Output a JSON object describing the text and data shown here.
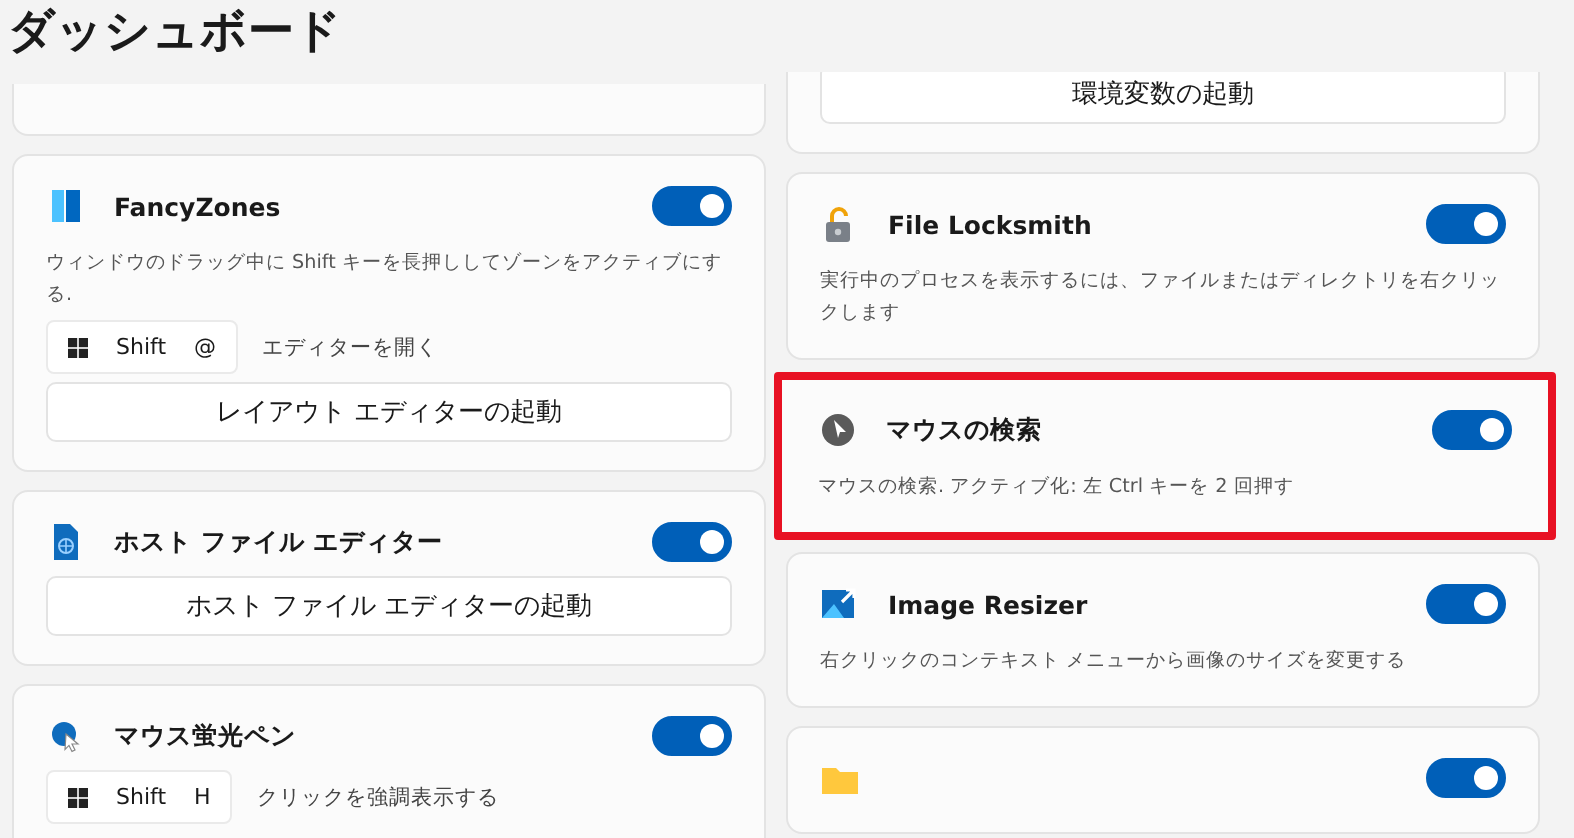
{
  "title": "ダッシュボード",
  "columns": [
    {
      "cards": [
        {
          "kind": "blank"
        },
        {
          "kind": "fancyzones",
          "title": "FancyZones",
          "enabled": true,
          "description": "ウィンドウのドラッグ中に Shift キーを長押ししてゾーンをアクティブにする.",
          "shortcut": {
            "keys": [
              "Shift",
              "@"
            ],
            "label": "エディターを開く"
          },
          "button": "レイアウト エディターの起動"
        },
        {
          "kind": "hosts",
          "title": "ホスト ファイル エディター",
          "enabled": true,
          "button": "ホスト ファイル エディターの起動"
        },
        {
          "kind": "highlighter",
          "title": "マウス蛍光ペン",
          "enabled": true,
          "shortcut": {
            "keys": [
              "Shift",
              "H"
            ],
            "label": "クリックを強調表示する"
          }
        }
      ]
    },
    {
      "cards": [
        {
          "kind": "launcher",
          "button": "環境変数の起動"
        },
        {
          "kind": "locksmith",
          "title": "File Locksmith",
          "enabled": true,
          "description": "実行中のプロセスを表示するには、ファイルまたはディレクトリを右クリックします"
        },
        {
          "kind": "finder",
          "title": "マウスの検索",
          "enabled": true,
          "highlighted": true,
          "description": "マウスの検索. アクティブ化: 左 Ctrl キーを 2 回押す"
        },
        {
          "kind": "resizer",
          "title": "Image Resizer",
          "enabled": true,
          "description": "右クリックのコンテキスト メニューから画像のサイズを変更する"
        },
        {
          "kind": "folder",
          "enabled": true
        }
      ]
    }
  ]
}
